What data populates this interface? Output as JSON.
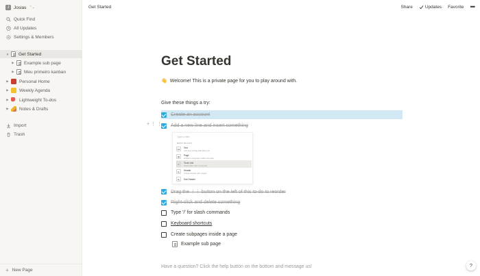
{
  "workspace": {
    "avatar_letter": "J",
    "name": "Josias",
    "chevron": "⌃⌄"
  },
  "sidebar": {
    "top_items": [
      {
        "label": "Quick Find",
        "icon": "search-icon"
      },
      {
        "label": "All Updates",
        "icon": "clock-icon"
      },
      {
        "label": "Settings & Members",
        "icon": "gear-icon"
      }
    ],
    "pages": [
      {
        "label": "Get Started",
        "icon": "page-icon",
        "active": true
      },
      {
        "label": "Example sub page",
        "icon": "page-icon"
      },
      {
        "label": "Meu primeiro kanban",
        "icon": "page-icon"
      },
      {
        "label": "Personal Home",
        "icon": "book-emoji"
      },
      {
        "label": "Weekly Agenda",
        "icon": "notebook-emoji"
      },
      {
        "label": "Lightweight To-dos",
        "icon": "pin-emoji"
      },
      {
        "label": "Notes & Drafts",
        "icon": "pencil-emoji"
      }
    ],
    "bottom_items": [
      {
        "label": "Import",
        "icon": "download-icon"
      },
      {
        "label": "Trash",
        "icon": "trash-icon"
      }
    ],
    "new_page": "New Page"
  },
  "topbar": {
    "breadcrumb": "Get Started",
    "share": "Share",
    "updates": "Updates",
    "favorite": "Favorite",
    "more": "•••"
  },
  "page": {
    "title": "Get Started",
    "welcome_emoji": "👋",
    "welcome": "Welcome! This is a private page for you to play around with.",
    "prompt": "Give these things a try:",
    "todos": [
      {
        "text": "Create an account",
        "checked": true
      },
      {
        "text": "Add a new line and insert something",
        "checked": true
      },
      {
        "text": "Drag the ⋮⋮ button on the left of this to-do to reorder",
        "checked": true
      },
      {
        "text": "Right-click and delete something",
        "checked": true
      },
      {
        "text": "Type '/' for slash commands",
        "checked": false
      },
      {
        "text": "Keyboard shortcuts",
        "checked": false
      },
      {
        "text": "Create subpages inside a page",
        "checked": false
      }
    ],
    "subpage_link": "Example sub page",
    "question": "Have a question? Click the help button on the bottom and message us!",
    "help": "?"
  },
  "embedded_menu": {
    "filter": "Type to filter",
    "heading": "BASIC BLOCKS",
    "options": [
      {
        "icon": "Aa",
        "label": "Text",
        "desc": "Just start writing with plain text."
      },
      {
        "icon": "▤",
        "label": "Page",
        "desc": "Embed a sub-page inside this page."
      },
      {
        "icon": "☑",
        "label": "To-do List",
        "desc": "Track tasks with a to-do list.",
        "selected": true
      },
      {
        "icon": "H₁",
        "label": "Header",
        "desc": "A large header with margin."
      },
      {
        "icon": "H₂",
        "label": "Sub Header",
        "desc": ""
      }
    ]
  },
  "colors": {
    "accent": "#2eaadc",
    "sidebar_bg": "#f7f6f3",
    "highlight": "#d3e8f5",
    "text": "#37352f",
    "muted": "#9b9a97"
  }
}
